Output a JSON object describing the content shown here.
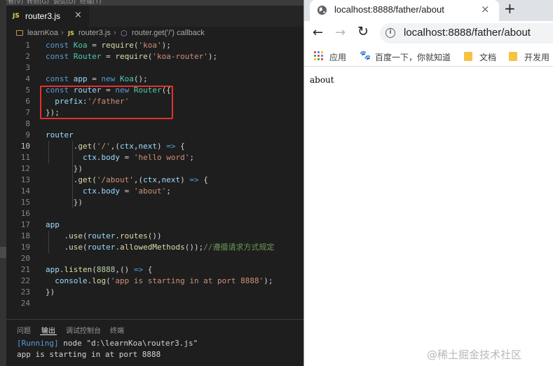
{
  "menu_strip": [
    "查看(V)",
    "转到(G)",
    "调试(D)",
    "终端(T)"
  ],
  "editor": {
    "tab": {
      "icon": "js-icon",
      "icon_text": "JS",
      "title": "router3.js"
    },
    "breadcrumb": [
      "learnKoa",
      "router3.js",
      "router.get('/') callback"
    ],
    "current_line": 10,
    "code_lines": [
      [
        [
          "kw",
          "const "
        ],
        [
          "cls",
          "Koa"
        ],
        [
          "pun",
          " = "
        ],
        [
          "fn",
          "require"
        ],
        [
          "pun",
          "("
        ],
        [
          "str",
          "'koa'"
        ],
        [
          "pun",
          ");"
        ]
      ],
      [
        [
          "kw",
          "const "
        ],
        [
          "cls",
          "Router"
        ],
        [
          "pun",
          " = "
        ],
        [
          "fn",
          "require"
        ],
        [
          "pun",
          "("
        ],
        [
          "str",
          "'koa-router'"
        ],
        [
          "pun",
          ");"
        ]
      ],
      [],
      [
        [
          "kw",
          "const "
        ],
        [
          "var",
          "app"
        ],
        [
          "pun",
          " = "
        ],
        [
          "kw",
          "new "
        ],
        [
          "cls",
          "Koa"
        ],
        [
          "pun",
          "();"
        ]
      ],
      [
        [
          "kw",
          "const "
        ],
        [
          "var",
          "router"
        ],
        [
          "pun",
          " = "
        ],
        [
          "kw",
          "new "
        ],
        [
          "cls",
          "Router"
        ],
        [
          "pun",
          "({"
        ]
      ],
      [
        [
          "pun",
          "  "
        ],
        [
          "var",
          "prefix"
        ],
        [
          "pun",
          ":"
        ],
        [
          "str",
          "'/father'"
        ]
      ],
      [
        [
          "pun",
          "});"
        ]
      ],
      [],
      [
        [
          "var",
          "router"
        ]
      ],
      [
        [
          "pun",
          "      ."
        ],
        [
          "fn",
          "get"
        ],
        [
          "pun",
          "("
        ],
        [
          "str",
          "'/'"
        ],
        [
          "pun",
          ",("
        ],
        [
          "var",
          "ctx"
        ],
        [
          "pun",
          ","
        ],
        [
          "var",
          "next"
        ],
        [
          "pun",
          ") "
        ],
        [
          "kw",
          "=>"
        ],
        [
          "pun",
          " {"
        ]
      ],
      [
        [
          "pun",
          "        "
        ],
        [
          "var",
          "ctx"
        ],
        [
          "pun",
          "."
        ],
        [
          "var",
          "body"
        ],
        [
          "pun",
          " = "
        ],
        [
          "str",
          "'hello word'"
        ],
        [
          "pun",
          ";"
        ]
      ],
      [
        [
          "pun",
          "      })"
        ]
      ],
      [
        [
          "pun",
          "      ."
        ],
        [
          "fn",
          "get"
        ],
        [
          "pun",
          "("
        ],
        [
          "str",
          "'/about'"
        ],
        [
          "pun",
          ",("
        ],
        [
          "var",
          "ctx"
        ],
        [
          "pun",
          ","
        ],
        [
          "var",
          "next"
        ],
        [
          "pun",
          ") "
        ],
        [
          "kw",
          "=>"
        ],
        [
          "pun",
          " {"
        ]
      ],
      [
        [
          "pun",
          "        "
        ],
        [
          "var",
          "ctx"
        ],
        [
          "pun",
          "."
        ],
        [
          "var",
          "body"
        ],
        [
          "pun",
          " = "
        ],
        [
          "str",
          "'about'"
        ],
        [
          "pun",
          ";"
        ]
      ],
      [
        [
          "pun",
          "      })"
        ]
      ],
      [],
      [
        [
          "var",
          "app"
        ]
      ],
      [
        [
          "pun",
          "    ."
        ],
        [
          "fn",
          "use"
        ],
        [
          "pun",
          "("
        ],
        [
          "var",
          "router"
        ],
        [
          "pun",
          "."
        ],
        [
          "fn",
          "routes"
        ],
        [
          "pun",
          "())"
        ]
      ],
      [
        [
          "pun",
          "    ."
        ],
        [
          "fn",
          "use"
        ],
        [
          "pun",
          "("
        ],
        [
          "var",
          "router"
        ],
        [
          "pun",
          "."
        ],
        [
          "fn",
          "allowedMethods"
        ],
        [
          "pun",
          "());"
        ],
        [
          "cmt",
          "//遵循请求方式规定"
        ]
      ],
      [],
      [
        [
          "var",
          "app"
        ],
        [
          "pun",
          "."
        ],
        [
          "fn",
          "listen"
        ],
        [
          "pun",
          "("
        ],
        [
          "num",
          "8888"
        ],
        [
          "pun",
          ",() "
        ],
        [
          "kw",
          "=>"
        ],
        [
          "pun",
          " {"
        ]
      ],
      [
        [
          "pun",
          "  "
        ],
        [
          "var",
          "console"
        ],
        [
          "pun",
          "."
        ],
        [
          "fn",
          "log"
        ],
        [
          "pun",
          "("
        ],
        [
          "str",
          "'app is starting in at port 8888'"
        ],
        [
          "pun",
          ");"
        ]
      ],
      [
        [
          "pun",
          "})"
        ]
      ],
      []
    ]
  },
  "panel": {
    "tabs": [
      "问题",
      "输出",
      "调试控制台",
      "终端"
    ],
    "active_tab": 1,
    "output": {
      "line1_tag": "[Running]",
      "line1_rest": " node \"d:\\learnKoa\\router3.js\"",
      "line2": "app is starting in at port 8888"
    }
  },
  "browser": {
    "tab_title": "localhost:8888/father/about",
    "tab_close": "×",
    "new_tab": "+",
    "back": "←",
    "forward": "→",
    "reload": "↻",
    "info": "i",
    "url": "localhost:8888/father/about",
    "bookmarks": [
      {
        "icon": "apps-grid-icon",
        "label": "应用"
      },
      {
        "icon": "baidu-paw-icon",
        "label": "百度一下，你就知道"
      },
      {
        "icon": "folder-icon",
        "label": "文档"
      },
      {
        "icon": "folder-icon",
        "label": "开发用"
      }
    ],
    "body_text": "about"
  },
  "watermark": "@稀土掘金技术社区",
  "colors": {
    "editor_bg": "#1e1e1e",
    "highlight_box": "#e5302a",
    "keyword": "#569cd6",
    "class": "#4ec9b0",
    "string": "#ce9178",
    "comment": "#6a9955"
  }
}
